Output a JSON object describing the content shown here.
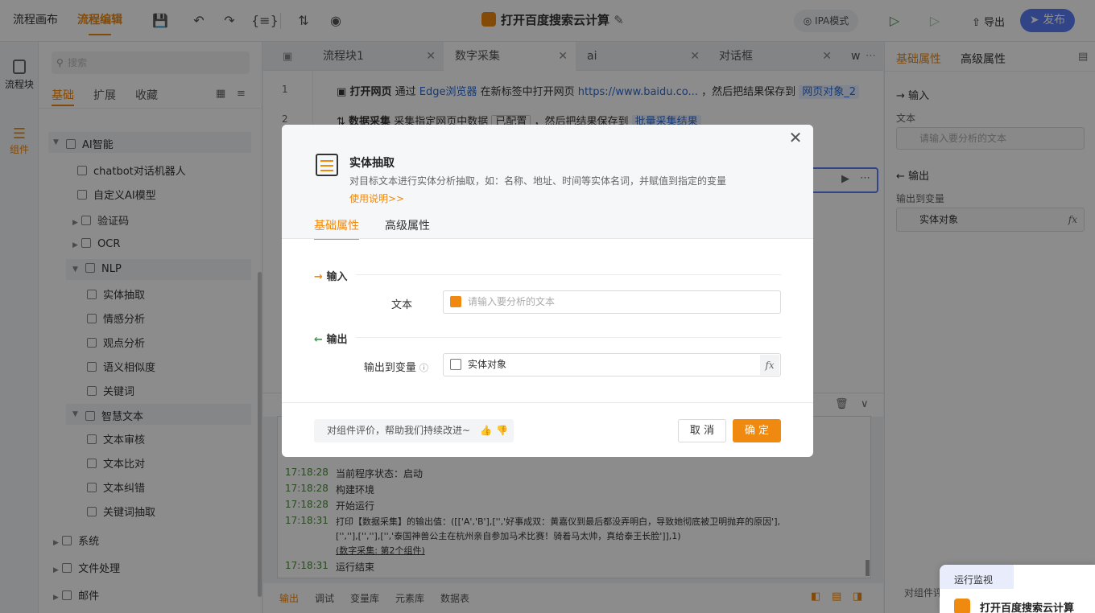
{
  "topbar": {
    "tabs": [
      "流程画布",
      "流程编辑"
    ],
    "title": "打开百度搜索云计算",
    "ipa_mode": "IPA模式",
    "export": "导出",
    "publish": "发布"
  },
  "rail": {
    "items": [
      "流程块",
      "组件"
    ]
  },
  "components": {
    "search_placeholder": "搜索",
    "tabs": [
      "基础",
      "扩展",
      "收藏"
    ],
    "tree": [
      {
        "label": "AI智能",
        "level": 0
      },
      {
        "label": "chatbot对话机器人",
        "level": 1
      },
      {
        "label": "自定义AI模型",
        "level": 1
      },
      {
        "label": "验证码",
        "level": 1
      },
      {
        "label": "OCR",
        "level": 1
      },
      {
        "label": "NLP",
        "level": 1
      },
      {
        "label": "实体抽取",
        "level": 2
      },
      {
        "label": "情感分析",
        "level": 2
      },
      {
        "label": "观点分析",
        "level": 2
      },
      {
        "label": "语义相似度",
        "level": 2
      },
      {
        "label": "关键词",
        "level": 2
      },
      {
        "label": "智慧文本",
        "level": 1
      },
      {
        "label": "文本审核",
        "level": 2
      },
      {
        "label": "文本比对",
        "level": 2
      },
      {
        "label": "文本纠错",
        "level": 2
      },
      {
        "label": "关键词抽取",
        "level": 2
      },
      {
        "label": "系统",
        "level": 0
      },
      {
        "label": "文件处理",
        "level": 0
      },
      {
        "label": "邮件",
        "level": 0
      }
    ]
  },
  "editor": {
    "tabs": [
      "流程块1",
      "数字采集",
      "ai",
      "对话框",
      "w"
    ],
    "steps": [
      {
        "no": "1",
        "name": "打开网页",
        "pre": "通过",
        "browser": "Edge浏览器",
        "mid": "在新标签中打开网页",
        "url": "https://www.baidu.co...",
        "post": "，然后把结果保存到",
        "var": "网页对象_2"
      },
      {
        "no": "2",
        "name": "数据采集",
        "pre": "采集指定网页中数据",
        "cfg": "已配置",
        "post": "，然后把结果保存到",
        "var": "批量采集结果"
      }
    ]
  },
  "log": {
    "lines": [
      {
        "time": "17:18:28",
        "msg": "当前程序状态：启动"
      },
      {
        "time": "17:18:28",
        "msg": "构建环境"
      },
      {
        "time": "17:18:28",
        "msg": "开始运行"
      },
      {
        "time": "17:18:31",
        "msg": "打印【数据采集】的输出值：([['A','B'],['','好事成双：黄嘉仪到最后都没弄明白，导致她彻底被卫明抛弃的原因'],"
      },
      {
        "time": "",
        "msg": "['',''],['',''],['','泰国神兽公主在杭州亲自参加马术比赛！骑着马太帅，真给泰王长脸']],1)"
      },
      {
        "time": "17:18:31",
        "msg": "运行结束"
      }
    ],
    "link": "(数字采集: 第2个组件)",
    "bottom_tabs": [
      "输出",
      "调试",
      "变量库",
      "元素库",
      "数据表"
    ]
  },
  "right_panel": {
    "tabs": [
      "基础属性",
      "高级属性"
    ],
    "input_section": "输入",
    "text_label": "文本",
    "text_placeholder": "请输入要分析的文本",
    "output_section": "输出",
    "output_label": "输出到变量",
    "output_value": "实体对象",
    "bottom": "对组件评"
  },
  "monitor": {
    "label": "运行监视",
    "title": "打开百度搜索云计算"
  },
  "modal": {
    "title": "实体抽取",
    "description": "对目标文本进行实体分析抽取，如：名称、地址、时间等实体名词，并赋值到指定的变量",
    "help": "使用说明>>",
    "tabs": [
      "基础属性",
      "高级属性"
    ],
    "input_section": "输入",
    "text_label": "文本",
    "text_placeholder": "请输入要分析的文本",
    "output_section": "输出",
    "output_label": "输出到变量",
    "output_value": "实体对象",
    "feedback": "对组件评价，帮助我们持续改进~",
    "cancel": "取 消",
    "ok": "确 定"
  }
}
